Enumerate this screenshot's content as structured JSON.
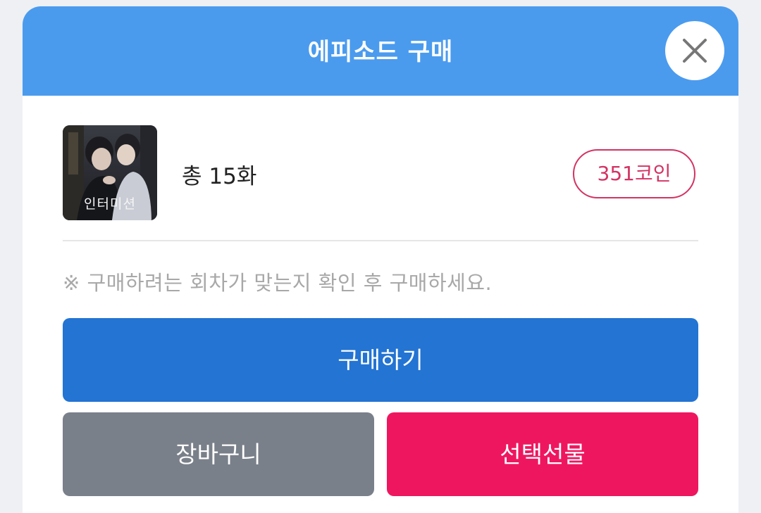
{
  "header": {
    "title": "에피소드 구매",
    "close_icon": "close-icon"
  },
  "product": {
    "thumbnail_title": "인터미션",
    "episodes": "총 15화",
    "price": "351코인"
  },
  "notice": "※ 구매하려는 회차가 맞는지 확인 후 구매하세요.",
  "buttons": {
    "buy": "구매하기",
    "cart": "장바구니",
    "gift": "선택선물"
  },
  "colors": {
    "header": "#4a9bee",
    "buy": "#2374d3",
    "cart": "#7a808a",
    "gift": "#ef1660",
    "price": "#d33363"
  }
}
